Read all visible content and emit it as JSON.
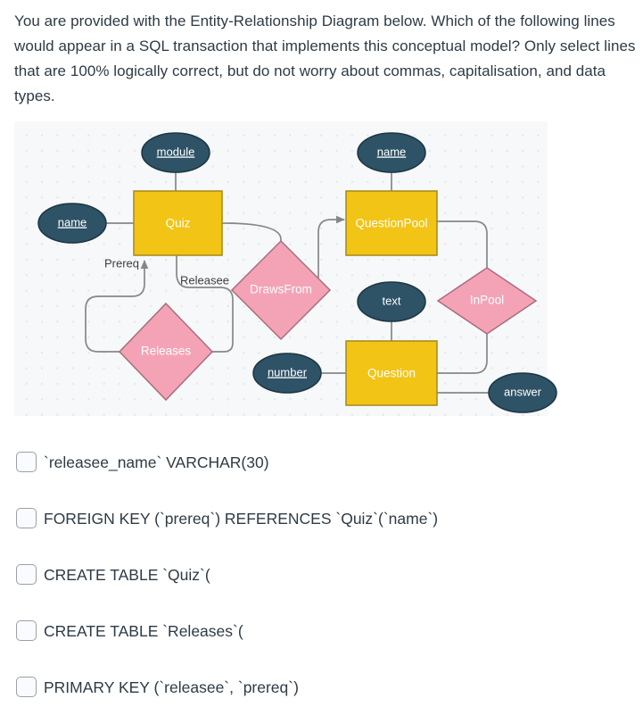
{
  "question": {
    "stem": "You are provided with the Entity-Relationship Diagram below. Which of the following lines would appear in a SQL transaction that implements this conceptual model? Only select lines that are 100% logically correct, but do not worry about commas, capitalisation, and data types."
  },
  "diagram": {
    "type": "entity-relationship-diagram",
    "colors": {
      "entity_fill": "#f2c416",
      "entity_stroke": "#ab8e1e",
      "attribute_fill": "#2e5266",
      "attribute_stroke": "#1d3643",
      "relationship_fill": "#f4a3b6",
      "relationship_stroke": "#a86e7c",
      "edge_stroke": "#878787",
      "panel_background": "#f7f8fa"
    },
    "entities": [
      {
        "id": "quiz",
        "label": "Quiz"
      },
      {
        "id": "questionpool",
        "label": "QuestionPool"
      },
      {
        "id": "question",
        "label": "Question"
      }
    ],
    "attributes": [
      {
        "id": "quiz_module",
        "label": "module",
        "key": true,
        "owner": "Quiz"
      },
      {
        "id": "quiz_name",
        "label": "name",
        "key": true,
        "owner": "Quiz"
      },
      {
        "id": "pool_name",
        "label": "name",
        "key": true,
        "owner": "QuestionPool"
      },
      {
        "id": "question_text",
        "label": "text",
        "key": false,
        "owner": "Question"
      },
      {
        "id": "question_number",
        "label": "number",
        "key": true,
        "owner": "Question"
      },
      {
        "id": "question_answer",
        "label": "answer",
        "key": false,
        "owner": "Question"
      }
    ],
    "relationships": [
      {
        "id": "releases",
        "label": "Releases"
      },
      {
        "id": "drawsfrom",
        "label": "DrawsFrom"
      },
      {
        "id": "inpool",
        "label": "InPool"
      }
    ],
    "edge_labels": [
      {
        "id": "prereq",
        "label": "Prereq"
      },
      {
        "id": "releasee",
        "label": "Releasee"
      }
    ]
  },
  "options": [
    {
      "id": "opt-1",
      "label": "`releasee_name` VARCHAR(30)",
      "checked": false
    },
    {
      "id": "opt-2",
      "label": "FOREIGN KEY (`prereq`) REFERENCES `Quiz`(`name`)",
      "checked": false
    },
    {
      "id": "opt-3",
      "label": "CREATE TABLE `Quiz`(",
      "checked": false
    },
    {
      "id": "opt-4",
      "label": "CREATE TABLE `Releases`(",
      "checked": false
    },
    {
      "id": "opt-5",
      "label": "PRIMARY KEY (`releasee`, `prereq`)",
      "checked": false
    }
  ]
}
